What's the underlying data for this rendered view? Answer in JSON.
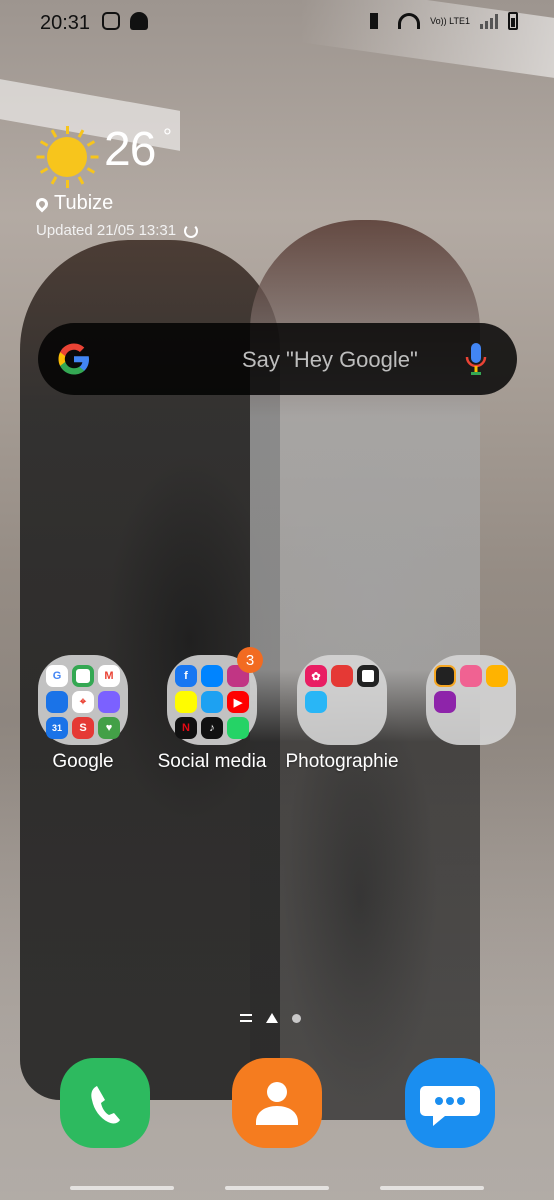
{
  "status_bar": {
    "time": "20:31",
    "network_label": "Vo)) LTE1"
  },
  "weather": {
    "temperature": "26",
    "unit": "°",
    "location": "Tubize",
    "updated": "Updated 21/05 13:31",
    "icon": "sun-icon"
  },
  "search": {
    "placeholder": "Say \"Hey Google\""
  },
  "folders": [
    {
      "label": "Google",
      "badge": ""
    },
    {
      "label": "Social media",
      "badge": "3"
    },
    {
      "label": "Photographie",
      "badge": ""
    },
    {
      "label": "",
      "badge": ""
    }
  ],
  "dock": [
    {
      "name": "Phone",
      "icon": "phone-icon",
      "color": "#2dba5f"
    },
    {
      "name": "Contacts",
      "icon": "contacts-icon",
      "color": "#f57c1f"
    },
    {
      "name": "Messages",
      "icon": "messages-icon",
      "color": "#1a8ef0"
    }
  ],
  "colors": {
    "sun": "#f7c51c",
    "badge": "#f26b21"
  }
}
